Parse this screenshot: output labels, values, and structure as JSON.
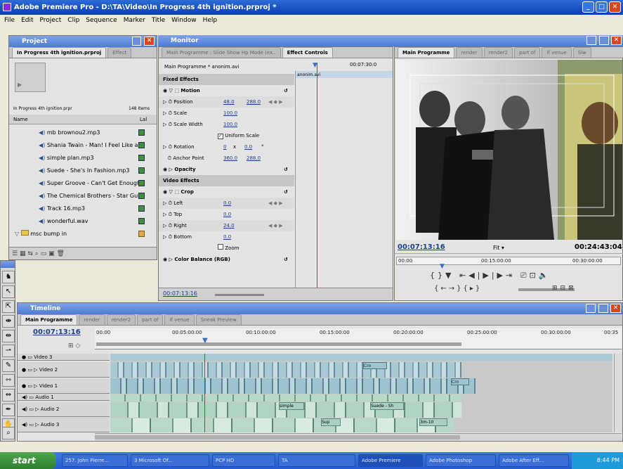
{
  "app": {
    "title": "Adobe Premiere Pro - D:\\TA\\Video\\In Progress 4th ignition.prproj *",
    "menu": [
      "File",
      "Edit",
      "Project",
      "Clip",
      "Sequence",
      "Marker",
      "Title",
      "Window",
      "Help"
    ]
  },
  "project": {
    "panel_title": "Project",
    "tab": "In Progress 4th ignition.prproj",
    "tab2": "Effect",
    "bin_name": "In Progress 4th ignition.prpr",
    "item_count": "148 Items",
    "col_name": "Name",
    "col_label": "Lal",
    "items": [
      {
        "name": "mb brownou2.mp3",
        "label": "#3f8f3f"
      },
      {
        "name": "Shania Twain - Man! I Feel Like a",
        "label": "#3f8f3f"
      },
      {
        "name": "simple plan.mp3",
        "label": "#3f8f3f"
      },
      {
        "name": "Suede - She's In Fashion.mp3",
        "label": "#3f8f3f"
      },
      {
        "name": "Super Groove - Can't Get Enough",
        "label": "#3f8f3f"
      },
      {
        "name": "The Chemical Brothers - Star Gui",
        "label": "#3f8f3f"
      },
      {
        "name": "Track 16.mp3",
        "label": "#3f8f3f"
      },
      {
        "name": "wonderful.wav",
        "label": "#3f8f3f"
      }
    ],
    "folder": "msc bump in"
  },
  "monitor": {
    "panel_title": "Monitor",
    "source_tabs": [
      "Main Programme : Slide Show Hp Mode (ex..",
      "Effect Controls"
    ],
    "clip_name": "Main Programme * anonim.avi",
    "ruler_time": "00:07:30:0",
    "track_clip": "anonim.avi",
    "fixed_effects": "Fixed Effects",
    "motion": "Motion",
    "position_label": "Position",
    "position_x": "48.0",
    "position_y": "288.0",
    "scale_label": "Scale",
    "scale_val": "100.0",
    "scale_width_label": "Scale Width",
    "scale_width_val": "100.0",
    "uniform_scale": "Uniform Scale",
    "rotation_label": "Rotation",
    "rotation_a": "0",
    "rotation_x": "x",
    "rotation_b": "0.0",
    "rotation_deg": "°",
    "anchor_label": "Anchor Point",
    "anchor_x": "360.0",
    "anchor_y": "288.0",
    "opacity": "Opacity",
    "video_effects": "Video Effects",
    "crop": "Crop",
    "left_label": "Left",
    "left_val": "0.0",
    "top_label": "Top",
    "top_val": "0.0",
    "right_label": "Right",
    "right_val": "24.0",
    "bottom_label": "Bottom",
    "bottom_val": "0.0",
    "zoom_label": "Zoom",
    "color_balance": "Color Balance (RGB)",
    "ec_timecode": "00:07:13:16"
  },
  "program": {
    "tabs": [
      "Main Programme",
      "render",
      "render2",
      "part of",
      "if venue",
      "Slw"
    ],
    "timecode": "00:07:13:16",
    "fit": "Fit",
    "duration": "00:24:43:04",
    "ruler": [
      "00:00",
      "00:15:00:00",
      "00:30:00:00"
    ]
  },
  "timeline": {
    "panel_title": "Timeline",
    "tabs": [
      "Main Programme",
      "render",
      "render2",
      "part of",
      "if venue",
      "Sneak Preview"
    ],
    "timecode": "00:07:13:16",
    "ruler": [
      "00:00",
      "00:05:00:00",
      "00:10:00:00",
      "00:15:00:00",
      "00:20:00:00",
      "00:25:00:00",
      "00:30:00:00",
      "00:35"
    ],
    "tracks": [
      "Video 3",
      "Video 2",
      "Video 1",
      "Audio 1",
      "Audio 2",
      "Audio 3"
    ],
    "clip_labels": [
      "Suede - Sh",
      "simple",
      "Sup",
      "3m-10",
      "Cro"
    ]
  },
  "taskbar": {
    "start": "start",
    "items": [
      "257. John Pierre...",
      "3 Microsoft Of...",
      "PCP HD",
      "TA",
      "Adobe Premiere",
      "Adobe Photoshop",
      "Adobe After Eff..."
    ],
    "clock": "8:44 PM"
  }
}
